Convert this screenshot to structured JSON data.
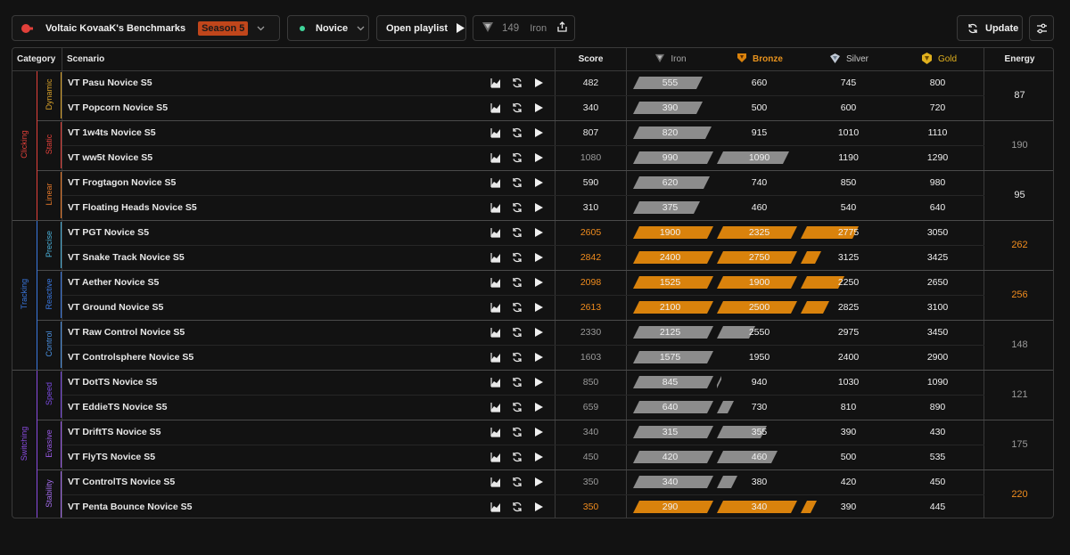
{
  "header": {
    "app_title": "Voltaic KovaaK's Benchmarks",
    "season": "Season 5",
    "difficulty": "Novice",
    "open_playlist": "Open playlist",
    "rank_score": "149",
    "rank_name": "Iron",
    "update": "Update"
  },
  "columns": {
    "category": "Category",
    "scenario": "Scenario",
    "score": "Score",
    "iron": "Iron",
    "bronze": "Bronze",
    "silver": "Silver",
    "gold": "Gold",
    "energy": "Energy"
  },
  "colors": {
    "iron": "#8c8c8c",
    "bronze": "#d9820c",
    "silver": "#c0c8d4",
    "gold": "#e0b01e",
    "clicking": "#e2403a",
    "tracking": "#3a78e0",
    "switching": "#8a4be0",
    "orange_text": "#f08c1e"
  },
  "categories": [
    {
      "name": "Clicking",
      "color": "#e2403a",
      "subs": [
        {
          "name": "Dynamic",
          "color": "#d8a12a",
          "energy": "87",
          "energy_color": "#e8e8e8"
        },
        {
          "name": "Static",
          "color": "#e2403a",
          "energy": "190",
          "energy_color": "#9a9a9a"
        },
        {
          "name": "Linear",
          "color": "#e87a2a",
          "energy": "95",
          "energy_color": "#e8e8e8"
        }
      ]
    },
    {
      "name": "Tracking",
      "color": "#3a78e0",
      "subs": [
        {
          "name": "Precise",
          "color": "#4ab0d8",
          "energy": "262",
          "energy_color": "#f08c1e"
        },
        {
          "name": "Reactive",
          "color": "#3a78e0",
          "energy": "256",
          "energy_color": "#f08c1e"
        },
        {
          "name": "Control",
          "color": "#4a90e0",
          "energy": "148",
          "energy_color": "#9a9a9a"
        }
      ]
    },
    {
      "name": "Switching",
      "color": "#8a4be0",
      "subs": [
        {
          "name": "Speed",
          "color": "#7a4ae0",
          "energy": "121",
          "energy_color": "#9a9a9a"
        },
        {
          "name": "Evasive",
          "color": "#9a5ae8",
          "energy": "175",
          "energy_color": "#9a9a9a"
        },
        {
          "name": "Stability",
          "color": "#a06ae8",
          "energy": "220",
          "energy_color": "#f08c1e"
        }
      ]
    }
  ],
  "rows": [
    {
      "scenario": "VT Pasu Novice S5",
      "score": "482",
      "score_color": "#e8e8e8",
      "thresholds": [
        "555",
        "660",
        "745",
        "800"
      ],
      "progress": 0.87,
      "bar_color": "#8c8c8c"
    },
    {
      "scenario": "VT Popcorn Novice S5",
      "score": "340",
      "score_color": "#e8e8e8",
      "thresholds": [
        "390",
        "500",
        "600",
        "720"
      ],
      "progress": 0.87,
      "bar_color": "#8c8c8c"
    },
    {
      "scenario": "VT 1w4ts Novice S5",
      "score": "807",
      "score_color": "#e8e8e8",
      "thresholds": [
        "820",
        "915",
        "1010",
        "1110"
      ],
      "progress": 0.98,
      "bar_color": "#8c8c8c"
    },
    {
      "scenario": "VT ww5t Novice S5",
      "score": "1080",
      "score_color": "#9a9a9a",
      "thresholds": [
        "990",
        "1090",
        "1190",
        "1290"
      ],
      "progress": 1.9,
      "bar_color": "#8c8c8c"
    },
    {
      "scenario": "VT Frogtagon Novice S5",
      "score": "590",
      "score_color": "#e8e8e8",
      "thresholds": [
        "620",
        "740",
        "850",
        "980"
      ],
      "progress": 0.95,
      "bar_color": "#8c8c8c"
    },
    {
      "scenario": "VT Floating Heads Novice S5",
      "score": "310",
      "score_color": "#e8e8e8",
      "thresholds": [
        "375",
        "460",
        "540",
        "640"
      ],
      "progress": 0.83,
      "bar_color": "#8c8c8c"
    },
    {
      "scenario": "VT PGT Novice S5",
      "score": "2605",
      "score_color": "#f08c1e",
      "thresholds": [
        "1900",
        "2325",
        "2775",
        "3050"
      ],
      "progress": 2.72,
      "bar_color": "#d9820c"
    },
    {
      "scenario": "VT Snake Track Novice S5",
      "score": "2842",
      "score_color": "#f08c1e",
      "thresholds": [
        "2400",
        "2750",
        "3125",
        "3425"
      ],
      "progress": 2.25,
      "bar_color": "#d9820c"
    },
    {
      "scenario": "VT Aether Novice S5",
      "score": "2098",
      "score_color": "#f08c1e",
      "thresholds": [
        "1525",
        "1900",
        "2250",
        "2650"
      ],
      "progress": 2.55,
      "bar_color": "#d9820c"
    },
    {
      "scenario": "VT Ground Novice S5",
      "score": "2613",
      "score_color": "#f08c1e",
      "thresholds": [
        "2100",
        "2500",
        "2825",
        "3100"
      ],
      "progress": 2.35,
      "bar_color": "#d9820c"
    },
    {
      "scenario": "VT Raw Control Novice S5",
      "score": "2330",
      "score_color": "#9a9a9a",
      "thresholds": [
        "2125",
        "2550",
        "2975",
        "3450"
      ],
      "progress": 1.48,
      "bar_color": "#8c8c8c"
    },
    {
      "scenario": "VT Controlsphere Novice S5",
      "score": "1603",
      "score_color": "#9a9a9a",
      "thresholds": [
        "1575",
        "1950",
        "2400",
        "2900"
      ],
      "progress": 1.08,
      "bar_color": "#8c8c8c"
    },
    {
      "scenario": "VT DotTS Novice S5",
      "score": "850",
      "score_color": "#9a9a9a",
      "thresholds": [
        "845",
        "940",
        "1030",
        "1090"
      ],
      "progress": 1.05,
      "bar_color": "#8c8c8c"
    },
    {
      "scenario": "VT EddieTS Novice S5",
      "score": "659",
      "score_color": "#9a9a9a",
      "thresholds": [
        "640",
        "730",
        "810",
        "890"
      ],
      "progress": 1.21,
      "bar_color": "#8c8c8c"
    },
    {
      "scenario": "VT DriftTS Novice S5",
      "score": "340",
      "score_color": "#9a9a9a",
      "thresholds": [
        "315",
        "355",
        "390",
        "430"
      ],
      "progress": 1.62,
      "bar_color": "#8c8c8c"
    },
    {
      "scenario": "VT FlyTS Novice S5",
      "score": "450",
      "score_color": "#9a9a9a",
      "thresholds": [
        "420",
        "460",
        "500",
        "535"
      ],
      "progress": 1.75,
      "bar_color": "#8c8c8c"
    },
    {
      "scenario": "VT ControlTS Novice S5",
      "score": "350",
      "score_color": "#9a9a9a",
      "thresholds": [
        "340",
        "380",
        "420",
        "450"
      ],
      "progress": 1.25,
      "bar_color": "#8c8c8c"
    },
    {
      "scenario": "VT Penta Bounce Novice S5",
      "score": "350",
      "score_color": "#f08c1e",
      "thresholds": [
        "290",
        "340",
        "390",
        "445"
      ],
      "progress": 2.2,
      "bar_color": "#d9820c"
    }
  ]
}
